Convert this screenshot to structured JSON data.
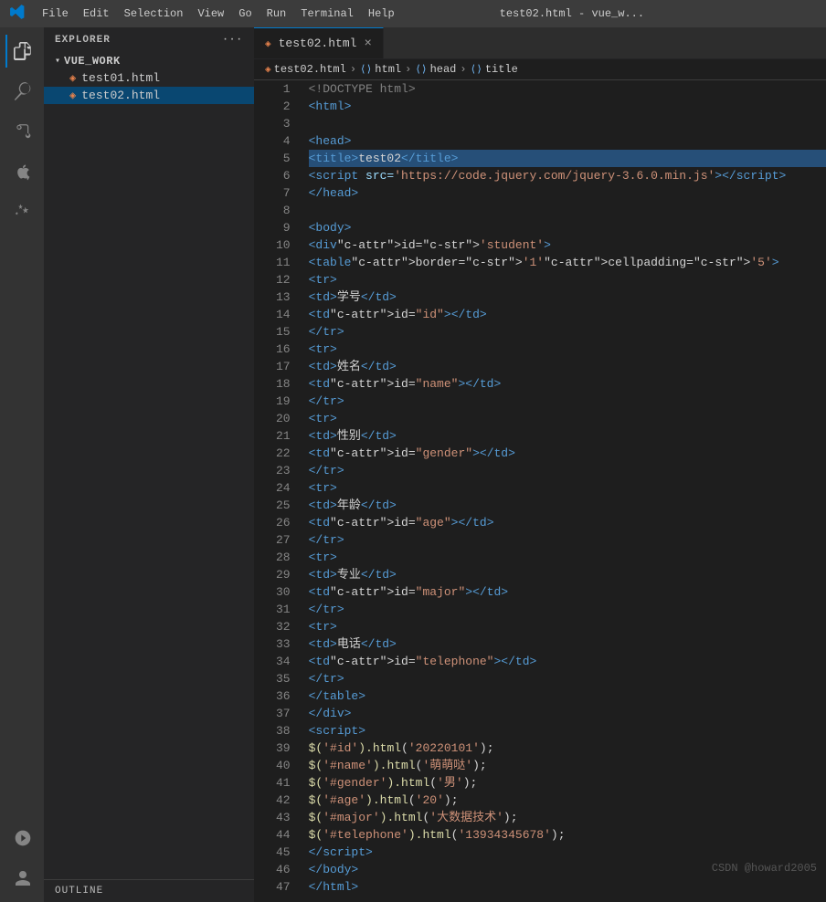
{
  "titleBar": {
    "logo": "VS",
    "menu": [
      "File",
      "Edit",
      "Selection",
      "View",
      "Go",
      "Run",
      "Terminal",
      "Help"
    ],
    "title": "test02.html - vue_w..."
  },
  "activityBar": {
    "icons": [
      {
        "name": "explorer-icon",
        "symbol": "⎘",
        "active": true
      },
      {
        "name": "search-icon",
        "symbol": "🔍",
        "active": false
      },
      {
        "name": "source-control-icon",
        "symbol": "⑂",
        "active": false
      },
      {
        "name": "debug-icon",
        "symbol": "▷",
        "active": false
      },
      {
        "name": "extensions-icon",
        "symbol": "⊞",
        "active": false
      }
    ],
    "bottomIcons": [
      {
        "name": "remote-icon",
        "symbol": "⊙"
      },
      {
        "name": "account-icon",
        "symbol": "👤"
      }
    ]
  },
  "sidebar": {
    "header": "EXPLORER",
    "headerEllipsis": "···",
    "folder": {
      "name": "VUE_WORK",
      "files": [
        {
          "name": "test01.html",
          "active": false
        },
        {
          "name": "test02.html",
          "active": true
        }
      ]
    },
    "outline": "OUTLINE"
  },
  "tabs": [
    {
      "label": "test02.html",
      "active": true,
      "hasClose": true
    }
  ],
  "breadcrumb": {
    "items": [
      "test02.html",
      "html",
      "head",
      "title"
    ]
  },
  "code": {
    "lines": [
      {
        "num": 1,
        "content": "<!DOCTYPE html>"
      },
      {
        "num": 2,
        "content": "<html>"
      },
      {
        "num": 3,
        "content": ""
      },
      {
        "num": 4,
        "content": "<head>"
      },
      {
        "num": 5,
        "content": "    <title>test02</title>",
        "highlighted": true
      },
      {
        "num": 6,
        "content": "    <script src='https://code.jquery.com/jquery-3.6.0.min.js'></script>"
      },
      {
        "num": 7,
        "content": "</head>"
      },
      {
        "num": 8,
        "content": ""
      },
      {
        "num": 9,
        "content": "<body>"
      },
      {
        "num": 10,
        "content": "    <div id='student'>"
      },
      {
        "num": 11,
        "content": "        <table border='1' cellpadding='5'>"
      },
      {
        "num": 12,
        "content": "            <tr>"
      },
      {
        "num": 13,
        "content": "                <td>学号</td>"
      },
      {
        "num": 14,
        "content": "                <td id=\"id\"></td>"
      },
      {
        "num": 15,
        "content": "            </tr>"
      },
      {
        "num": 16,
        "content": "            <tr>"
      },
      {
        "num": 17,
        "content": "                <td>姓名</td>"
      },
      {
        "num": 18,
        "content": "                <td id=\"name\"></td>"
      },
      {
        "num": 19,
        "content": "            </tr>"
      },
      {
        "num": 20,
        "content": "            <tr>"
      },
      {
        "num": 21,
        "content": "                <td>性别</td>"
      },
      {
        "num": 22,
        "content": "                <td id=\"gender\"></td>"
      },
      {
        "num": 23,
        "content": "            </tr>"
      },
      {
        "num": 24,
        "content": "            <tr>"
      },
      {
        "num": 25,
        "content": "                <td>年龄</td>"
      },
      {
        "num": 26,
        "content": "                <td id=\"age\"></td>"
      },
      {
        "num": 27,
        "content": "            </tr>"
      },
      {
        "num": 28,
        "content": "            <tr>"
      },
      {
        "num": 29,
        "content": "                <td>专业</td>"
      },
      {
        "num": 30,
        "content": "                <td id=\"major\"></td>"
      },
      {
        "num": 31,
        "content": "            </tr>"
      },
      {
        "num": 32,
        "content": "            <tr>"
      },
      {
        "num": 33,
        "content": "                <td>电话</td>"
      },
      {
        "num": 34,
        "content": "                <td id=\"telephone\"></td>"
      },
      {
        "num": 35,
        "content": "            </tr>"
      },
      {
        "num": 36,
        "content": "        </table>"
      },
      {
        "num": 37,
        "content": "    </div>"
      },
      {
        "num": 38,
        "content": "    <script>"
      },
      {
        "num": 39,
        "content": "        $('#id').html('20220101');"
      },
      {
        "num": 40,
        "content": "        $('#name').html('萌萌哒');"
      },
      {
        "num": 41,
        "content": "        $('#gender').html('男');"
      },
      {
        "num": 42,
        "content": "        $('#age').html('20');"
      },
      {
        "num": 43,
        "content": "        $('#major').html('大数据技术');"
      },
      {
        "num": 44,
        "content": "        $('#telephone').html('13934345678');"
      },
      {
        "num": 45,
        "content": "    </script>"
      },
      {
        "num": 46,
        "content": "</body>"
      },
      {
        "num": 47,
        "content": "</html>"
      }
    ]
  },
  "watermark": "CSDN @howard2005"
}
